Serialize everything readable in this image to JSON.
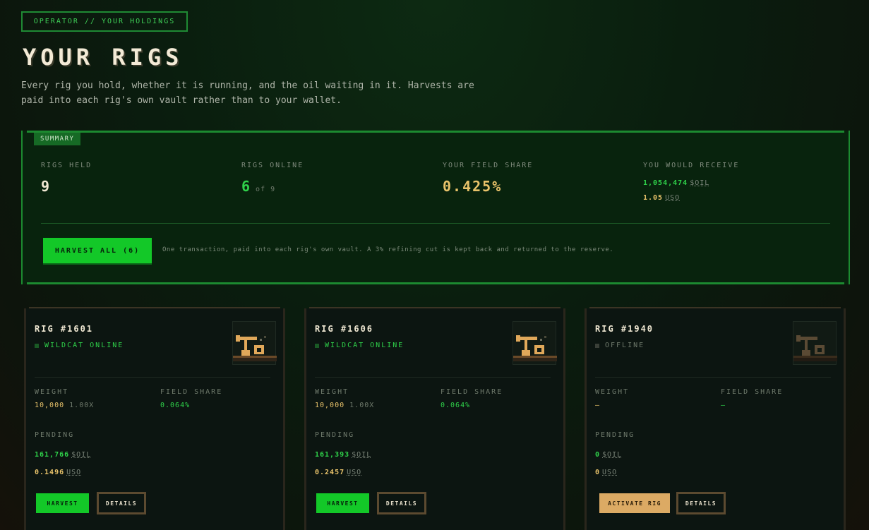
{
  "header": {
    "eyebrow": "OPERATOR // YOUR HOLDINGS",
    "title": "YOUR RIGS",
    "intro": "Every rig you hold, whether it is running, and the oil waiting in it. Harvests are paid into each rig's own vault rather than to your wallet."
  },
  "summary": {
    "tag": "SUMMARY",
    "rigs_held": {
      "label": "RIGS HELD",
      "value": "9"
    },
    "rigs_online": {
      "label": "RIGS ONLINE",
      "value": "6",
      "sub": "of 9"
    },
    "field_share": {
      "label": "YOUR FIELD SHARE",
      "value": "0.425%"
    },
    "receive": {
      "label": "YOU WOULD RECEIVE",
      "oil_amount": "1,054,474",
      "oil_unit": "$OIL",
      "uso_amount": "1.05",
      "uso_unit": "USO"
    },
    "harvest_all_label": "HARVEST ALL (6)",
    "note": "One transaction, paid into each rig's own vault. A 3% refining cut is kept back and returned to the reserve."
  },
  "labels": {
    "weight": "WEIGHT",
    "field_share": "FIELD SHARE",
    "pending": "PENDING",
    "details": "DETAILS"
  },
  "rigs": [
    {
      "name": "RIG #1601",
      "status": "WILDCAT ONLINE",
      "online": true,
      "weight": "10,000",
      "multiplier": "1.00X",
      "field_share": "0.064%",
      "pending_oil": "161,766",
      "oil_unit": "$OIL",
      "pending_uso": "0.1496",
      "uso_unit": "USO",
      "action": "HARVEST"
    },
    {
      "name": "RIG #1606",
      "status": "WILDCAT ONLINE",
      "online": true,
      "weight": "10,000",
      "multiplier": "1.00X",
      "field_share": "0.064%",
      "pending_oil": "161,393",
      "oil_unit": "$OIL",
      "pending_uso": "0.2457",
      "uso_unit": "USO",
      "action": "HARVEST"
    },
    {
      "name": "RIG #1940",
      "status": "OFFLINE",
      "online": false,
      "weight": "—",
      "multiplier": "",
      "field_share": "—",
      "pending_oil": "0",
      "oil_unit": "$OIL",
      "pending_uso": "0",
      "uso_unit": "USO",
      "action": "ACTIVATE RIG"
    }
  ],
  "colors": {
    "accent_green": "#13c828",
    "gold": "#e8c26a",
    "activate": "#dcaa64"
  }
}
